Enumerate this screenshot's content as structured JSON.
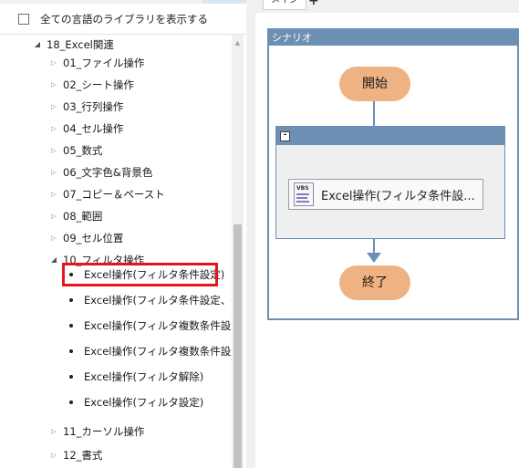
{
  "left_panel": {
    "show_all_label": "全ての言語のライブラリを表示する",
    "tree": [
      {
        "label": "18_Excel関連",
        "state": "expanded",
        "level": 0
      },
      {
        "label": "01_ファイル操作",
        "state": "collapsed",
        "level": 1
      },
      {
        "label": "02_シート操作",
        "state": "collapsed",
        "level": 1
      },
      {
        "label": "03_行列操作",
        "state": "collapsed",
        "level": 1
      },
      {
        "label": "04_セル操作",
        "state": "collapsed",
        "level": 1
      },
      {
        "label": "05_数式",
        "state": "collapsed",
        "level": 1
      },
      {
        "label": "06_文字色&背景色",
        "state": "collapsed",
        "level": 1
      },
      {
        "label": "07_コピー＆ペースト",
        "state": "collapsed",
        "level": 1
      },
      {
        "label": "08_範囲",
        "state": "collapsed",
        "level": 1
      },
      {
        "label": "09_セル位置",
        "state": "collapsed",
        "level": 1
      },
      {
        "label": "10_フィルタ操作",
        "state": "expanded",
        "level": 1
      },
      {
        "label": "Excel操作(フィルタ条件設定)",
        "state": "leaf",
        "level": 2,
        "highlighted": true
      },
      {
        "label": "Excel操作(フィルタ条件設定、件",
        "state": "leaf",
        "level": 2
      },
      {
        "label": "Excel操作(フィルタ複数条件設定",
        "state": "leaf",
        "level": 2
      },
      {
        "label": "Excel操作(フィルタ複数条件設定",
        "state": "leaf",
        "level": 2
      },
      {
        "label": "Excel操作(フィルタ解除)",
        "state": "leaf",
        "level": 2
      },
      {
        "label": "Excel操作(フィルタ設定)",
        "state": "leaf",
        "level": 2
      },
      {
        "label": "11_カーソル操作",
        "state": "collapsed",
        "level": 1
      },
      {
        "label": "12_書式",
        "state": "collapsed",
        "level": 1
      }
    ]
  },
  "editor": {
    "tab_label": "メイン",
    "add_tab_label": "+",
    "scenario_title": "シナリオ",
    "start_label": "開始",
    "end_label": "終了",
    "group_collapse_label": "-",
    "action_label": "Excel操作(フィルタ条件設...",
    "action_icon_text": "VBS"
  },
  "colors": {
    "accent_blue": "#6d8fb3",
    "terminal_orange": "#efb383",
    "highlight_red": "#e8141c"
  },
  "icons": {
    "tree_expanded": "triangle-down-right-icon",
    "tree_collapsed": "triangle-right-outline-icon",
    "leaf": "bullet-icon",
    "action": "vbs-script-icon"
  }
}
